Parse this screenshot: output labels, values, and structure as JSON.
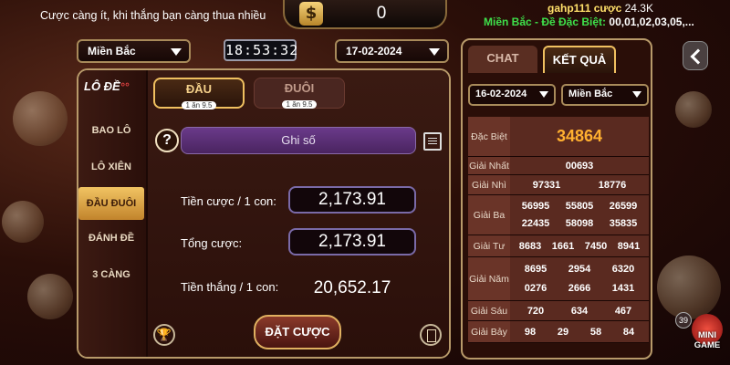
{
  "topbar": {
    "marquee": "Cược càng ít, khi thắng bạn càng thua nhiều",
    "coin_symbol": "$",
    "balance": "0",
    "feed_user": "gahp111 cược",
    "feed_amount": "24.3K",
    "feed_region": "Miền Bắc - Đề Đặc Biệt:",
    "feed_numbers": "00,01,02,03,05,..."
  },
  "controls": {
    "region": "Miền Bắc",
    "clock": "18:53:32",
    "date": "17-02-2024"
  },
  "sidebar": {
    "logo": "LÔ ĐỀ",
    "items": [
      {
        "label": "BAO LÔ"
      },
      {
        "label": "LÔ XIÊN"
      },
      {
        "label": "ĐẦU ĐUÔI"
      },
      {
        "label": "ĐÁNH ĐỀ"
      },
      {
        "label": "3 CÀNG"
      }
    ]
  },
  "tabs": [
    {
      "label": "ĐẦU",
      "sub": "1 ăn 9.5"
    },
    {
      "label": "ĐUÔI",
      "sub": "1 ăn 9.5"
    }
  ],
  "bet": {
    "help": "?",
    "input_placeholder": "Ghi số",
    "stake_label": "Tiền cược / 1 con:",
    "stake_value": "2,173.91",
    "total_label": "Tổng cược:",
    "total_value": "2,173.91",
    "win_label": "Tiền thắng / 1 con:",
    "win_value": "20,652.17",
    "button": "ĐẶT CƯỢC"
  },
  "results": {
    "tab_chat": "CHAT",
    "tab_results": "KẾT QUẢ",
    "date": "16-02-2024",
    "region": "Miền Bắc",
    "rows": [
      {
        "label": "Đặc Biệt",
        "values": [
          "34864"
        ]
      },
      {
        "label": "Giải Nhất",
        "values": [
          "00693"
        ]
      },
      {
        "label": "Giải Nhì",
        "values": [
          "97331",
          "18776"
        ]
      },
      {
        "label": "Giải Ba",
        "values": [
          "56995",
          "55805",
          "26599",
          "22435",
          "58098",
          "35835"
        ]
      },
      {
        "label": "Giải Tư",
        "values": [
          "8683",
          "1661",
          "7450",
          "8941"
        ]
      },
      {
        "label": "Giải Năm",
        "values": [
          "8695",
          "2954",
          "6320",
          "0276",
          "2666",
          "1431"
        ]
      },
      {
        "label": "Giải Sáu",
        "values": [
          "720",
          "634",
          "467"
        ]
      },
      {
        "label": "Giải Bảy",
        "values": [
          "98",
          "29",
          "58",
          "84"
        ]
      }
    ]
  },
  "mini_game": {
    "count": "39",
    "label_line1": "MINI",
    "label_line2": "GAME"
  },
  "colors": {
    "accent_gold": "#f0c060",
    "special_prize": "#ffb030",
    "feed_region": "#3ee04a"
  }
}
